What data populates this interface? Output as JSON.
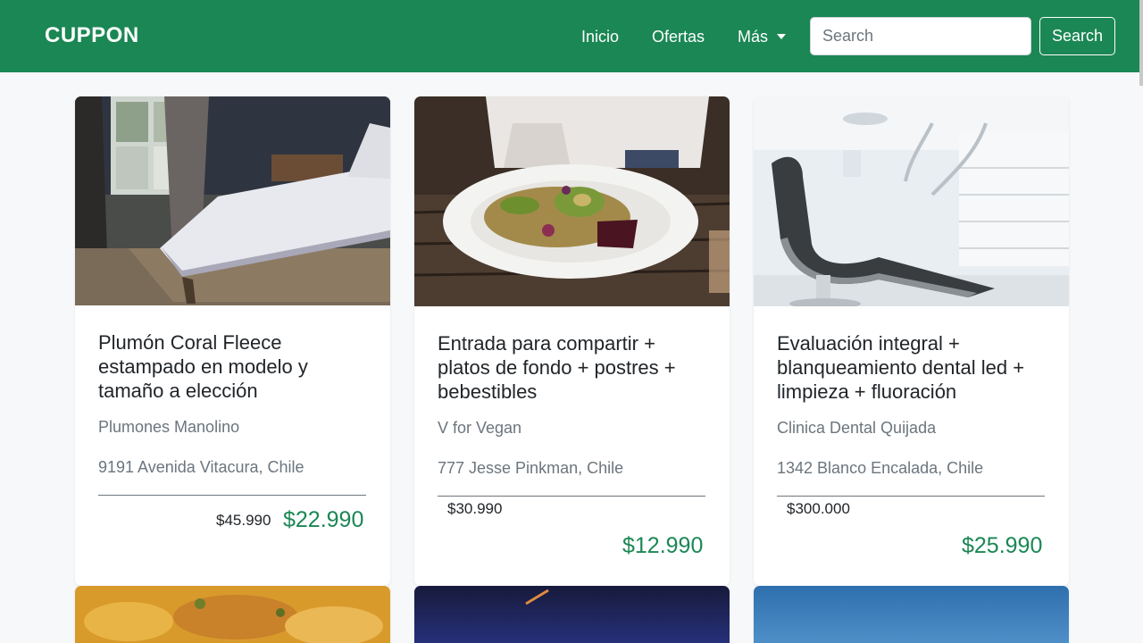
{
  "navbar": {
    "brand": "CUPPON",
    "links": [
      "Inicio",
      "Ofertas",
      "Más"
    ],
    "search_placeholder": "Search",
    "search_button": "Search",
    "background_color": "#1b8754"
  },
  "cards": [
    {
      "image_icon": "bedroom-photo",
      "title": "Plumón Coral Fleece estampado en modelo y tamaño a elección",
      "vendor": "Plumones Manolino",
      "address": "9191 Avenida Vitacura, Chile",
      "old_price": "$45.990",
      "new_price": "$22.990"
    },
    {
      "image_icon": "vegan-food-photo",
      "title": "Entrada para compartir + platos de fondo + postres + bebestibles",
      "vendor": "V for Vegan",
      "address": "777 Jesse Pinkman, Chile",
      "old_price": "$30.990",
      "new_price": "$12.990"
    },
    {
      "image_icon": "dental-chair-photo",
      "title": "Evaluación integral + blanqueamiento dental led + limpieza + fluoración",
      "vendor": "Clinica Dental Quijada",
      "address": "1342 Blanco Encalada, Chile",
      "old_price": "$300.000",
      "new_price": "$25.990"
    }
  ],
  "next_row_images": [
    "food-photo",
    "night-sky-photo",
    "blue-sky-photo"
  ],
  "price_color": "#1b8754"
}
